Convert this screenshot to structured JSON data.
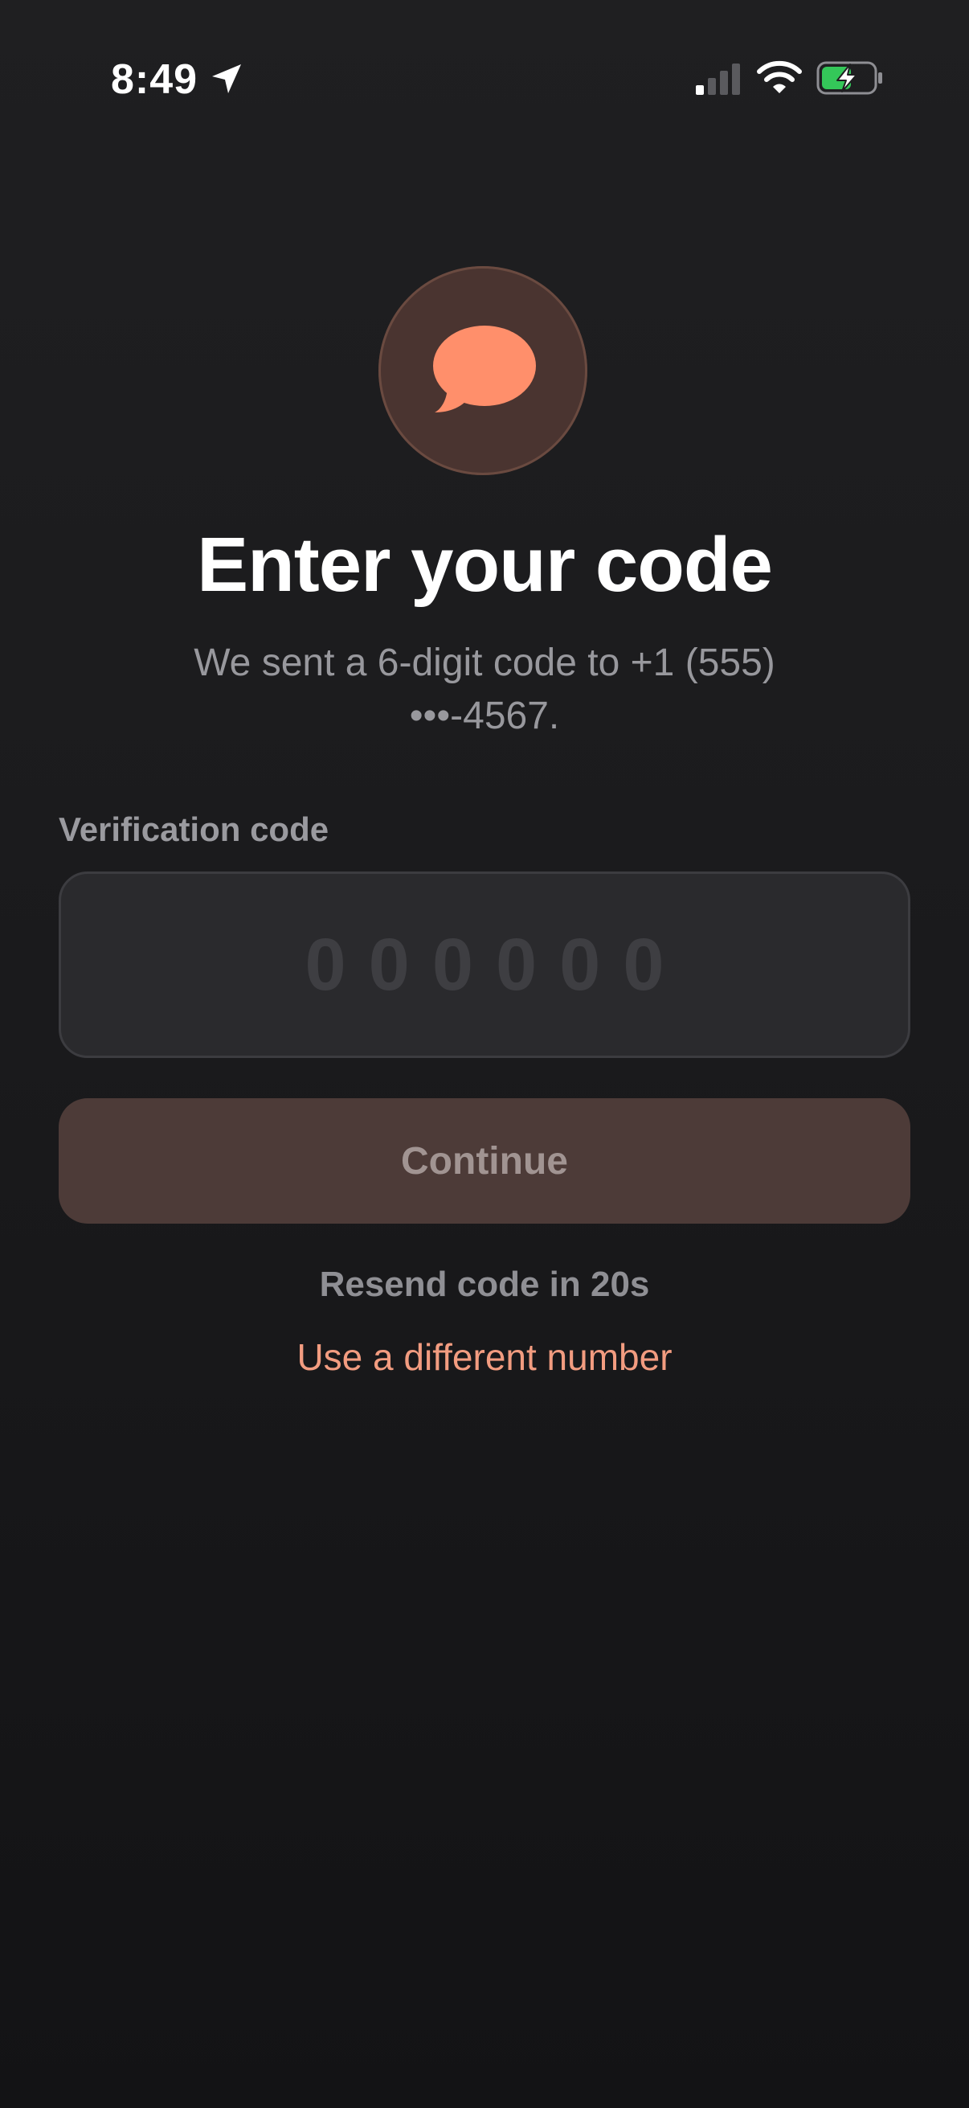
{
  "status_bar": {
    "time": "8:49",
    "icons": {
      "location": "location-arrow-icon",
      "signal": "cellular-signal-icon",
      "wifi": "wifi-icon",
      "battery": "battery-charging-icon"
    },
    "colors": {
      "battery_fill": "#34c759"
    }
  },
  "hero": {
    "icon": "chat-bubble-icon",
    "circle_color": "#4a3430",
    "bubble_color": "#ff8f6b"
  },
  "main": {
    "title": "Enter your code",
    "subtitle": "We sent a 6-digit code to +1 (555) •••-4567.",
    "field_label": "Verification code",
    "code_input": {
      "value": "",
      "placeholder": "000000"
    },
    "continue_label": "Continue",
    "resend_text": "Resend code in 20s",
    "different_number_label": "Use a different number"
  },
  "colors": {
    "accent": "#f29c80",
    "background": "#1c1c1e",
    "button_disabled": "#4d3b38"
  }
}
